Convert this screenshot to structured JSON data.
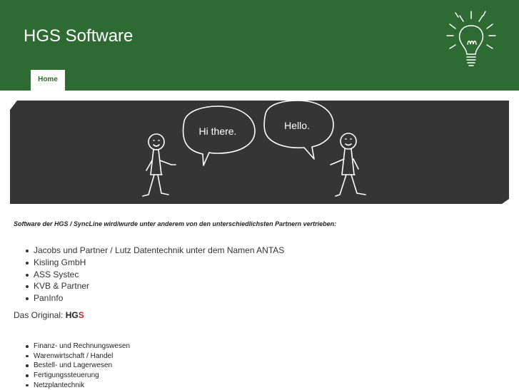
{
  "header": {
    "title": "HGS Software",
    "bg_color": "#2e6b33"
  },
  "nav": {
    "tabs": [
      {
        "label": "Home",
        "active": true
      }
    ]
  },
  "banner": {
    "speech_left": "Hi there.",
    "speech_right": "Hello.",
    "board_color": "#353535"
  },
  "content": {
    "intro": "Software der HGS / SyncLine wird/wurde unter anderem von den unterschiedlichsten Partnern vertrieben:",
    "partners": [
      "Jacobs und Partner / Lutz Datentechnik unter dem Namen ANTAS",
      "Kisling GmbH",
      "ASS Systec",
      "KVB & Partner",
      "PanInfo"
    ],
    "original_prefix": "Das Original: ",
    "original_hg": "HG",
    "original_s": "S",
    "features": [
      "Finanz- und Rechnungswesen",
      "Warenwirtschaft / Handel",
      "Bestell- und Lagerwesen",
      "Fertigungssteuerung",
      "Netzplantechnik"
    ]
  },
  "icons": {
    "bulb": "lightbulb-icon"
  }
}
